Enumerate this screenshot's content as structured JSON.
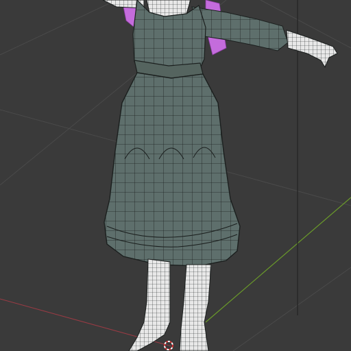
{
  "viewport": {
    "background": "#3a3a3a",
    "grid_color": "#4a4a4a",
    "x_axis_color": "#9a3a44",
    "y_axis_color": "#6a9a2a"
  },
  "model": {
    "dress_color": "#5e6f6c",
    "skin_wire_color": "#e6e6e6",
    "hair_color": "#c46cdc",
    "wire_color": "#1b1f1e"
  },
  "icons": {
    "origin": "3d-cursor-icon"
  }
}
